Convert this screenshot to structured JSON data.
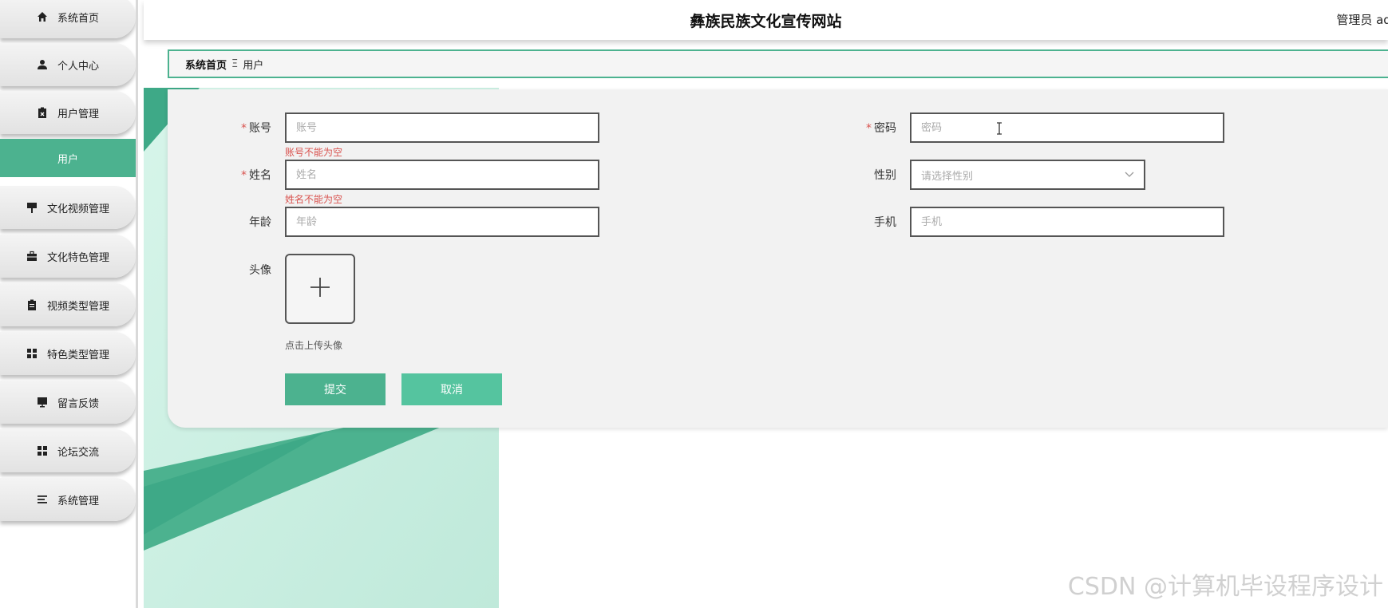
{
  "app": {
    "site_title": "彝族民族文化宣传网站",
    "user_info": "管理员 adr"
  },
  "sidebar": {
    "items": [
      {
        "label": "系统首页",
        "icon": "home-icon"
      },
      {
        "label": "个人中心",
        "icon": "person-icon"
      },
      {
        "label": "用户管理",
        "icon": "clipboard-icon"
      },
      {
        "label": "用户",
        "icon": ""
      },
      {
        "label": "文化视频管理",
        "icon": "sign-icon"
      },
      {
        "label": "文化特色管理",
        "icon": "briefcase-icon"
      },
      {
        "label": "视频类型管理",
        "icon": "clipboard-list-icon"
      },
      {
        "label": "特色类型管理",
        "icon": "grid-icon"
      },
      {
        "label": "留言反馈",
        "icon": "monitor-icon"
      },
      {
        "label": "论坛交流",
        "icon": "grid-icon"
      },
      {
        "label": "系统管理",
        "icon": "menu-icon"
      }
    ],
    "active_index": 3
  },
  "breadcrumb": {
    "home": "系统首页",
    "separator": "Ξ",
    "current": "用户"
  },
  "form": {
    "account": {
      "label": "账号",
      "placeholder": "账号",
      "value": "",
      "error": "账号不能为空",
      "required": true
    },
    "password": {
      "label": "密码",
      "placeholder": "密码",
      "value": "",
      "required": true
    },
    "name": {
      "label": "姓名",
      "placeholder": "姓名",
      "value": "",
      "error": "姓名不能为空",
      "required": true
    },
    "gender": {
      "label": "性别",
      "placeholder": "请选择性别",
      "value": ""
    },
    "age": {
      "label": "年龄",
      "placeholder": "年龄",
      "value": ""
    },
    "phone": {
      "label": "手机",
      "placeholder": "手机",
      "value": ""
    },
    "avatar": {
      "label": "头像",
      "hint": "点击上传头像"
    },
    "required_mark": "*"
  },
  "buttons": {
    "submit": "提交",
    "cancel": "取消"
  },
  "watermark": "CSDN @计算机毕设程序设计",
  "colors": {
    "accent": "#4cb28f",
    "error": "#d9534f",
    "bg_art_light": "#c9f0e2",
    "bg_art_dark": "#3ea987"
  }
}
